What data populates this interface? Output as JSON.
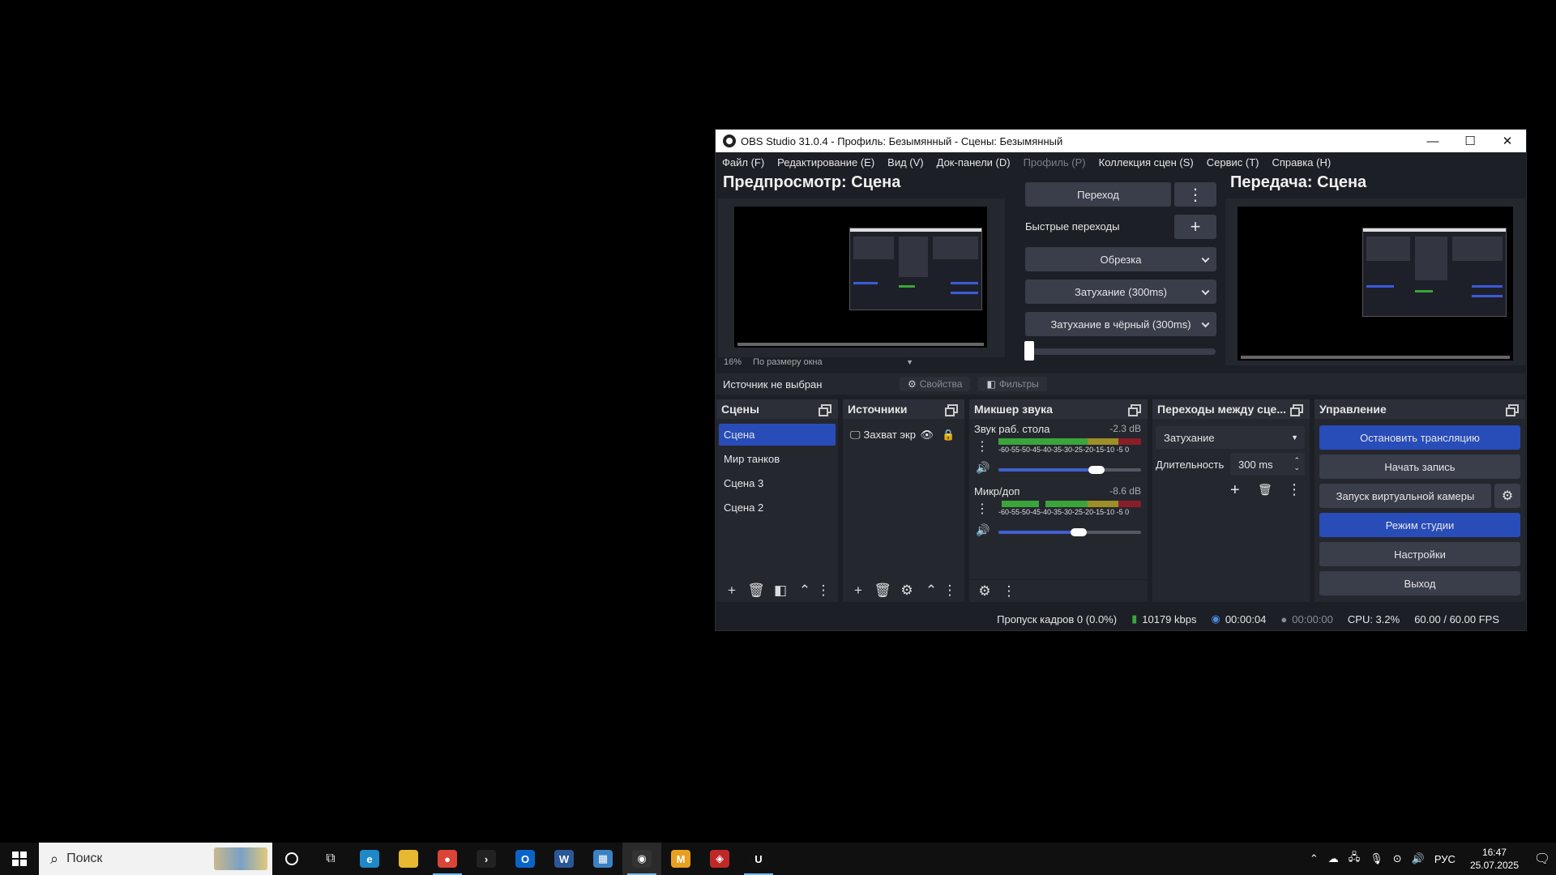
{
  "window": {
    "title": "OBS Studio 31.0.4 - Профиль: Безымянный - Сцены: Безымянный",
    "minimize": "—",
    "maximize": "☐",
    "close": "✕"
  },
  "menu": [
    {
      "label": "Файл (F)",
      "enabled": true
    },
    {
      "label": "Редактирование (E)",
      "enabled": true
    },
    {
      "label": "Вид (V)",
      "enabled": true
    },
    {
      "label": "Док-панели (D)",
      "enabled": true
    },
    {
      "label": "Профиль (P)",
      "enabled": false
    },
    {
      "label": "Коллекция сцен (S)",
      "enabled": true
    },
    {
      "label": "Сервис (T)",
      "enabled": true
    },
    {
      "label": "Справка (H)",
      "enabled": true
    }
  ],
  "preview": {
    "title": "Предпросмотр: Сцена",
    "zoom": "16%",
    "fit": "По размеру окна"
  },
  "program": {
    "title": "Передача: Сцена"
  },
  "transitions_center": {
    "transition_button": "Переход",
    "quick_label": "Быстрые переходы",
    "quick_items": [
      "Обрезка",
      "Затухание (300ms)",
      "Затухание в чёрный (300ms)"
    ]
  },
  "source_bar": {
    "no_source": "Источник не выбран",
    "properties": "Свойства",
    "filters": "Фильтры"
  },
  "scenes": {
    "header": "Сцены",
    "items": [
      "Сцена",
      "Мир танков",
      "Сцена 3",
      "Сцена 2"
    ],
    "selected": 0
  },
  "sources": {
    "header": "Источники",
    "items": [
      "Захват экр"
    ]
  },
  "mixer": {
    "header": "Микшер звука",
    "channels": [
      {
        "name": "Звук раб. стола",
        "db": "-2.3 dB",
        "scale": "-60-55-50-45-40-35-30-25-20-15-10 -5  0",
        "level": 0.69
      },
      {
        "name": "Микр/доп",
        "db": "-8.6 dB",
        "scale": "-60-55-50-45-40-35-30-25-20-15-10 -5  0",
        "level": 0.56
      }
    ]
  },
  "scene_transitions": {
    "header": "Переходы между сце...",
    "selected": "Затухание",
    "duration_label": "Длительность",
    "duration_value": "300 ms"
  },
  "controls": {
    "header": "Управление",
    "stop_stream": "Остановить трансляцию",
    "start_record": "Начать запись",
    "virtual_cam": "Запуск виртуальной камеры",
    "studio_mode": "Режим студии",
    "settings": "Настройки",
    "exit": "Выход"
  },
  "status": {
    "dropped": "Пропуск кадров 0 (0.0%)",
    "bitrate": "10179 kbps",
    "stream_time": "00:00:04",
    "record_time": "00:00:00",
    "cpu": "CPU: 3.2%",
    "fps": "60.00 / 60.00 FPS"
  },
  "taskbar": {
    "search_placeholder": "Поиск",
    "lang": "РУС",
    "time": "16:47",
    "date": "25.07.2025",
    "apps": [
      {
        "name": "edge-icon",
        "color": "#1e88c8",
        "glyph": "e"
      },
      {
        "name": "explorer-icon",
        "color": "#e8b830",
        "glyph": ""
      },
      {
        "name": "chrome-icon",
        "color": "#db4437",
        "glyph": "●"
      },
      {
        "name": "terminal-icon",
        "color": "#222222",
        "glyph": "›"
      },
      {
        "name": "outlook-icon",
        "color": "#0a64c8",
        "glyph": "O"
      },
      {
        "name": "word-icon",
        "color": "#2b5797",
        "glyph": "W"
      },
      {
        "name": "store-icon",
        "color": "#3b82c4",
        "glyph": "▦"
      },
      {
        "name": "obs-icon",
        "color": "#333333",
        "glyph": "◉"
      },
      {
        "name": "m-app-icon",
        "color": "#e8a020",
        "glyph": "M"
      },
      {
        "name": "red-app-icon",
        "color": "#c02828",
        "glyph": "◈"
      },
      {
        "name": "unreal-icon",
        "color": "#111111",
        "glyph": "U"
      }
    ]
  }
}
